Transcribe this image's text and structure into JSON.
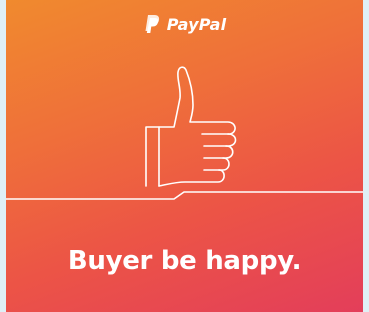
{
  "brand": {
    "name": "PayPal",
    "logo_icon": "paypal-p-icon"
  },
  "illustration": {
    "icon": "thumbs-up-icon"
  },
  "headline": "Buyer be happy.",
  "colors": {
    "gradient_start": "#f08a2e",
    "gradient_end": "#e33e5a",
    "text": "#ffffff",
    "frame": "#dff0f6"
  }
}
